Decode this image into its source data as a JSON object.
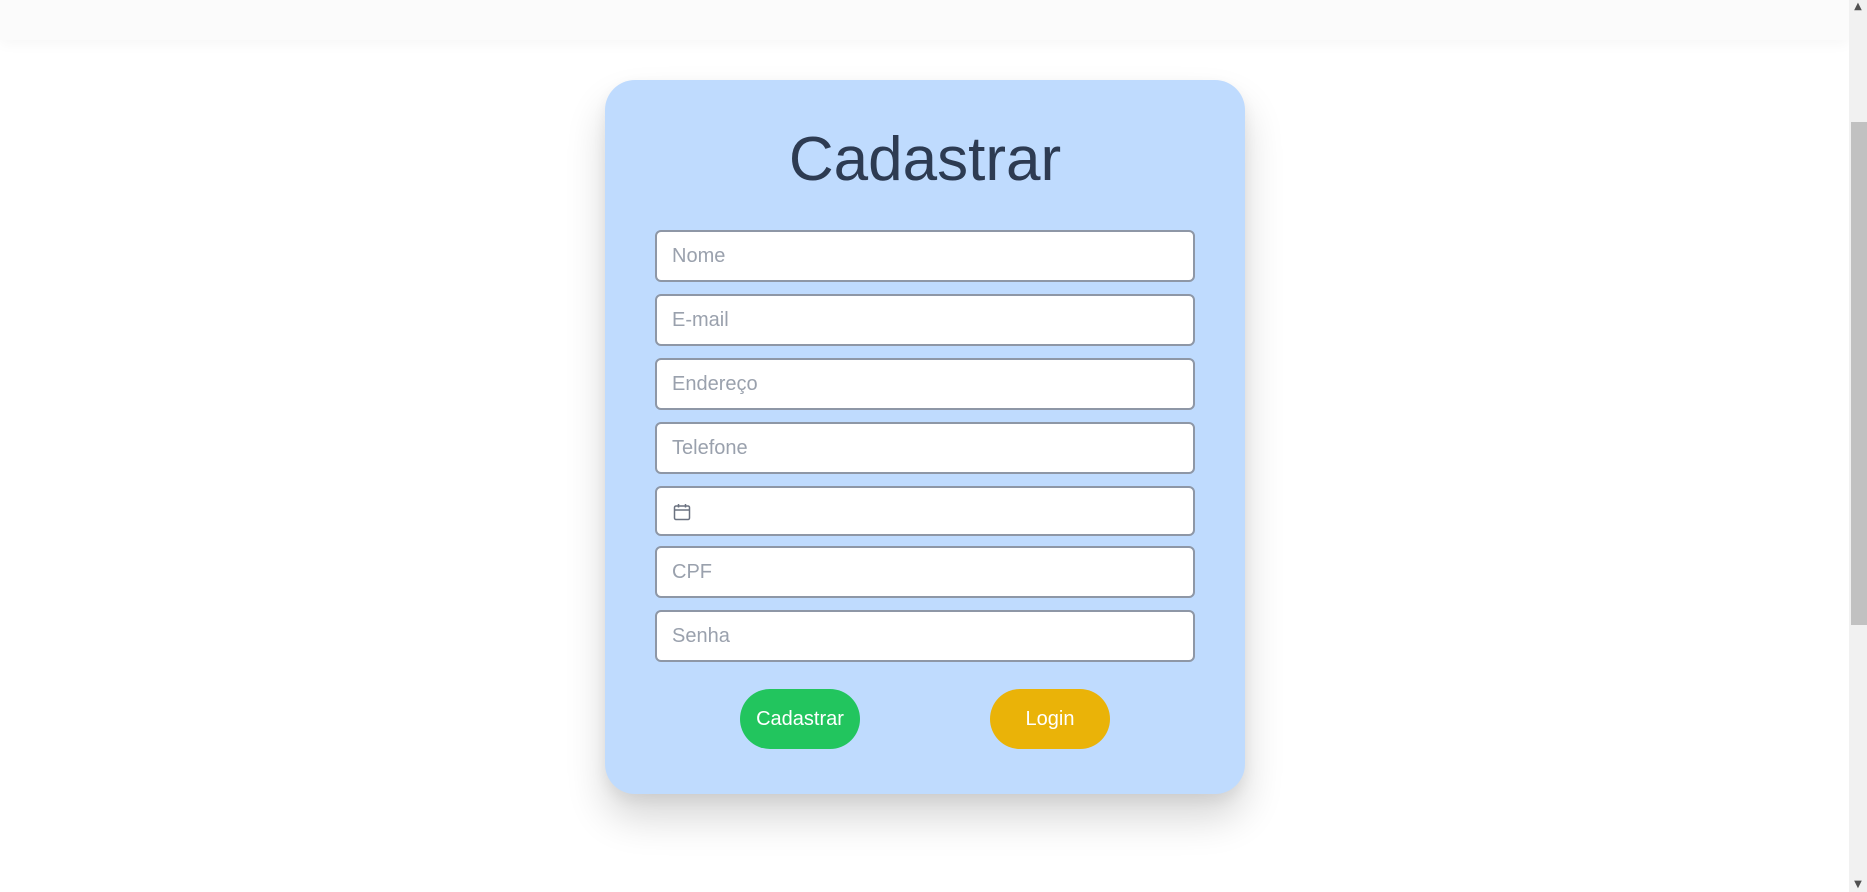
{
  "form": {
    "title": "Cadastrar",
    "fields": [
      {
        "name": "nome",
        "placeholder": "Nome",
        "value": ""
      },
      {
        "name": "email",
        "placeholder": "E-mail",
        "value": ""
      },
      {
        "name": "endereco",
        "placeholder": "Endereço",
        "value": ""
      },
      {
        "name": "telefone",
        "placeholder": "Telefone",
        "value": ""
      },
      {
        "name": "cpf",
        "placeholder": "CPF",
        "value": ""
      },
      {
        "name": "senha",
        "placeholder": "Senha",
        "value": ""
      }
    ],
    "date_field": {
      "icon": "calendar-icon",
      "value": ""
    },
    "buttons": {
      "register_label": "Cadastrar",
      "login_label": "Login"
    }
  },
  "colors": {
    "page_background": "#ffffff",
    "card_background": "#bfdbfe",
    "title_text": "#2d3b52",
    "register_button": "#22c55e",
    "login_button": "#eab308",
    "input_border": "#8e97a6",
    "placeholder_text": "#9aa1ad"
  },
  "scrollbar": {
    "up_icon": "chevron-up-icon",
    "down_icon": "chevron-down-icon"
  }
}
